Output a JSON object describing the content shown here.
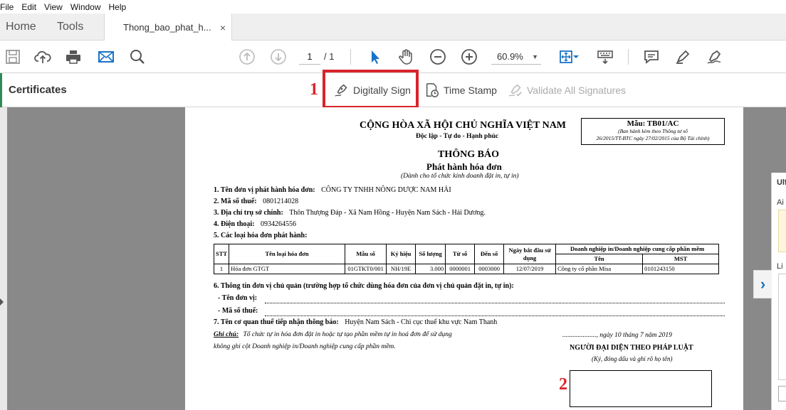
{
  "menu": [
    "File",
    "Edit",
    "View",
    "Window",
    "Help"
  ],
  "tabs": {
    "home": "Home",
    "tools": "Tools",
    "document": "Thong_bao_phat_h...",
    "close": "×"
  },
  "toolbar": {
    "page_current": "1",
    "page_total": "/ 1",
    "zoom": "60.9%"
  },
  "certificates": {
    "title": "Certificates",
    "digitally_sign": "Digitally Sign",
    "time_stamp": "Time Stamp",
    "validate_all": "Validate All Signatures",
    "label_1": "1",
    "label_2": "2"
  },
  "doc": {
    "header_nation": "CỘNG HÒA XÃ HỘI CHỦ NGHĨA VIỆT NAM",
    "header_motto": "Độc lập - Tự do - Hạnh phúc",
    "form_code": "Mẫu: TB01/AC",
    "form_note_1": "(Ban hành kèm theo Thông tư số",
    "form_note_2": "26/2015/TT-BTC ngày 27/02/2015 của Bộ Tài chính)",
    "title": "THÔNG BÁO",
    "subtitle": "Phát hành hóa đơn",
    "subtitle_note": "(Dành cho tổ chức kinh doanh đặt in, tự in)",
    "line1_label": "1. Tên đơn vị phát hành hóa đơn:",
    "line1_value": "CÔNG TY TNHH NÔNG DƯỢC NAM HẢI",
    "line2_label": "2. Mã số thuế:",
    "line2_value": "0801214028",
    "line3_label": "3. Địa chỉ trụ sở chính:",
    "line3_value": "Thôn Thượng Đáp - Xã Nam Hồng - Huyện Nam Sách - Hải Dương.",
    "line4_label": "4. Điện thoại:",
    "line4_value": "0934264556",
    "line5_label": "5. Các loại hóa đơn phát hành:",
    "table": {
      "headers": [
        "STT",
        "Tên loại hóa đơn",
        "Mẫu số",
        "Ký hiệu",
        "Số lượng",
        "Từ số",
        "Đến số",
        "Ngày bắt đầu sử dụng",
        "Doanh nghiệp in/Doanh nghiệp cung cấp phần mềm",
        "Tên",
        "MST"
      ],
      "row": [
        "1",
        "Hóa đơn GTGT",
        "01GTKT0/001",
        "NH/19E",
        "3.000",
        "0000001",
        "0003000",
        "12/07/2019",
        "Công ty cổ phần Misa",
        "0101243150"
      ]
    },
    "line6_label": "6. Thông tin đơn vị chủ quản (trường hợp tổ chức dùng hóa đơn của đơn vị chủ quản đặt in, tự in):",
    "line6a": "- Tên đơn vị:",
    "line6b": "- Mã số thuế:",
    "line7_label": "7. Tên cơ quan thuế tiếp nhận thông báo:",
    "line7_value": "Huyện Nam Sách - Chi cục thuế khu vực Nam Thanh",
    "note_label": "Ghi chú:",
    "note_text_1": "Tổ chức tự in hóa đơn đặt in hoặc tự tạo phần mềm tự in hoá đơn để sử dụng",
    "note_text_2": "không ghi cột Doanh nghiệp in/Doanh nghiệp cung cấp phần mềm.",
    "date_line": "...................., ngày 10 tháng 7 năm 2019",
    "rep_title": "NGƯỜI ĐẠI DIỆN THEO PHÁP LUẬT",
    "rep_note": "(Ký, đóng dấu và ghi rõ họ tên)"
  },
  "right_panel": {
    "t1": "Ulf",
    "t2": "Ai",
    "t3": "Li"
  }
}
